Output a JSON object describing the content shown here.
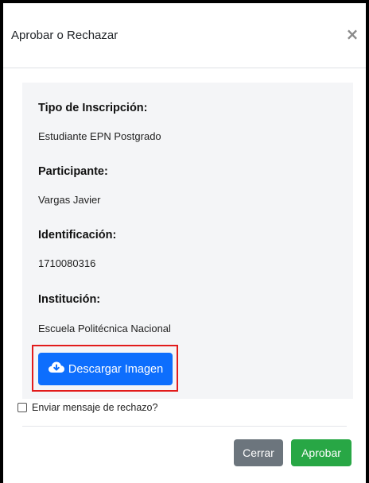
{
  "modal": {
    "title": "Aprobar o Rechazar",
    "close_symbol": "×"
  },
  "details": {
    "tipo_label": "Tipo de Inscripción:",
    "tipo_value": "Estudiante EPN Postgrado",
    "participante_label": "Participante:",
    "participante_value": "Vargas Javier",
    "identificacion_label": "Identificación:",
    "identificacion_value": "1710080316",
    "institucion_label": "Institución:",
    "institucion_value": "Escuela Politécnica Nacional"
  },
  "download": {
    "label": "Descargar Imagen",
    "icon": "cloud-download-icon"
  },
  "reject_message": {
    "label": "Enviar mensaje de rechazo?",
    "checked": false
  },
  "footer": {
    "close_label": "Cerrar",
    "approve_label": "Aprobar"
  },
  "colors": {
    "primary": "#0d6efd",
    "secondary": "#6c757d",
    "success": "#28a745",
    "highlight": "#e21b1b"
  }
}
